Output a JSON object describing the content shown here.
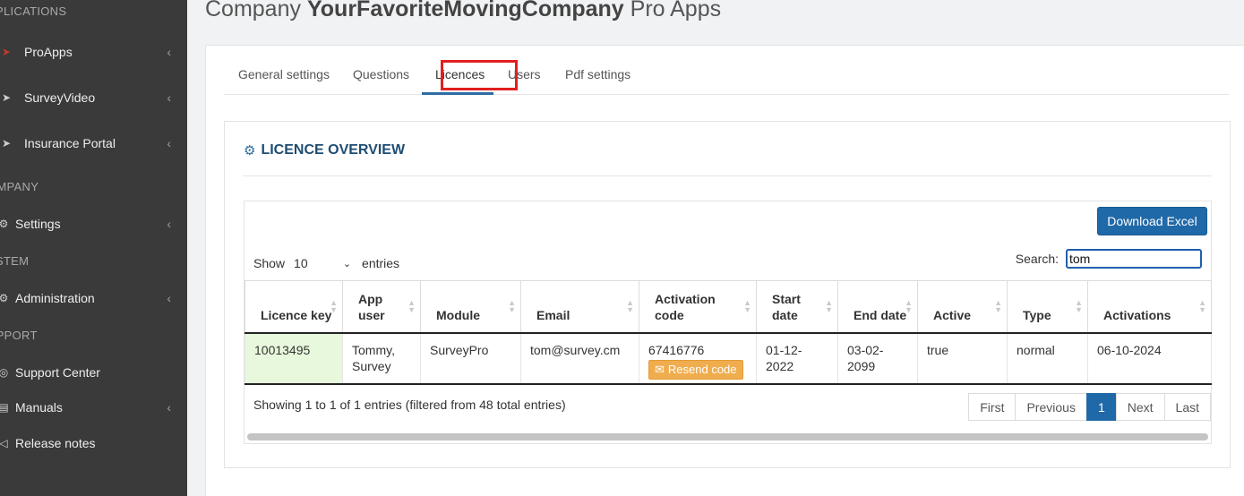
{
  "sidebar": {
    "sections": [
      {
        "label": "PPLICATIONS"
      },
      {
        "label": "OMPANY"
      },
      {
        "label": "YSTEM"
      },
      {
        "label": "UPPORT"
      }
    ],
    "items": [
      {
        "label": "ProApps",
        "icon": "arrow-right-icon",
        "icon_color": "#c0392b"
      },
      {
        "label": "SurveyVideo",
        "icon": "arrow-right-icon"
      },
      {
        "label": "Insurance Portal",
        "icon": "arrow-right-icon"
      },
      {
        "label": "Settings",
        "icon": "gear-icon"
      },
      {
        "label": "Administration",
        "icon": "gear-icon"
      },
      {
        "label": "Support Center",
        "icon": "support-icon"
      },
      {
        "label": "Manuals",
        "icon": "book-icon"
      },
      {
        "label": "Release notes",
        "icon": "megaphone-icon"
      }
    ]
  },
  "header": {
    "title_prefix": "Company",
    "company_name": "YourFavoriteMovingCompany",
    "title_suffix": "Pro Apps"
  },
  "tabs": [
    {
      "label": "General settings"
    },
    {
      "label": "Questions"
    },
    {
      "label": "Licences",
      "active": true
    },
    {
      "label": "Users"
    },
    {
      "label": "Pdf settings"
    }
  ],
  "overview": {
    "title": "LICENCE OVERVIEW",
    "download_label": "Download Excel",
    "show_label": "Show",
    "show_value": "10",
    "entries_label": "entries",
    "search_label": "Search:",
    "search_value": "tom"
  },
  "table": {
    "columns": [
      "Licence key",
      "App user",
      "Module",
      "Email",
      "Activation code",
      "Start date",
      "End date",
      "Active",
      "Type",
      "Activations"
    ],
    "rows": [
      {
        "licence_key": "10013495",
        "app_user": "Tommy, Survey",
        "module": "SurveyPro",
        "email": "tom@survey.cm",
        "activation_code": "67416776",
        "resend_label": "Resend code",
        "start_date": "01-12-2022",
        "end_date": "03-02-2099",
        "active": "true",
        "type": "normal",
        "activations": "06-10-2024"
      }
    ],
    "info": "Showing 1 to 1 of 1 entries (filtered from 48 total entries)"
  },
  "pagination": {
    "first": "First",
    "previous": "Previous",
    "current": "1",
    "next": "Next",
    "last": "Last"
  },
  "colors": {
    "accent": "#2069a8",
    "highlight": "#e0201f",
    "resend": "#f0ad4e",
    "key_cell": "#e8f8dc"
  }
}
